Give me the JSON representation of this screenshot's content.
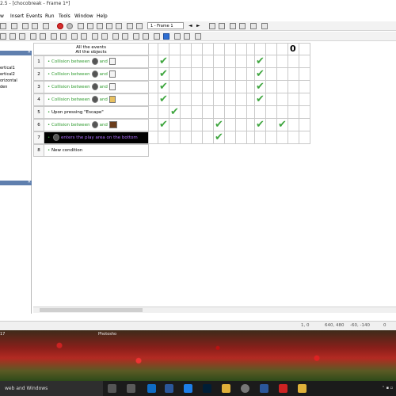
{
  "window": {
    "title": "2.5 - [chocobreak - Frame 1*]"
  },
  "menu": [
    "w",
    "Insert",
    "Events",
    "Run",
    "Tools",
    "Window",
    "Help"
  ],
  "toolbar": {
    "frame_select": "1 - Frame 1"
  },
  "left_panel": {
    "items": [
      "ertical1",
      "ertical2",
      "orizontal",
      "den"
    ]
  },
  "editor": {
    "header_line1": "All the events",
    "header_line2": "All the objects",
    "rows": [
      {
        "num": "1",
        "bullet": "•",
        "pre": "Collision between",
        "and": "and"
      },
      {
        "num": "2",
        "bullet": "•",
        "pre": "Collision between",
        "and": "and"
      },
      {
        "num": "3",
        "bullet": "•",
        "pre": "Collision between",
        "and": "and"
      },
      {
        "num": "4",
        "bullet": "•",
        "pre": "Collision between",
        "and": "and"
      },
      {
        "num": "5",
        "bullet": "•",
        "text": "Upon pressing \"Escape\""
      },
      {
        "num": "6",
        "bullet": "•",
        "pre": "Collision between",
        "and": "and"
      },
      {
        "num": "7",
        "bullet": "•",
        "text": "enters the play area on the bottom"
      },
      {
        "num": "8",
        "bullet": "•",
        "text": "New condition"
      }
    ],
    "zero_label": "0",
    "checkmarks": [
      [
        1,
        1
      ],
      [
        1,
        10
      ],
      [
        2,
        1
      ],
      [
        2,
        10
      ],
      [
        3,
        1
      ],
      [
        3,
        10
      ],
      [
        4,
        1
      ],
      [
        4,
        10
      ],
      [
        5,
        2
      ],
      [
        6,
        1
      ],
      [
        6,
        6
      ],
      [
        6,
        10
      ],
      [
        6,
        12
      ],
      [
        7,
        6
      ]
    ]
  },
  "status": {
    "pos": "1, 0",
    "size": "640, 480",
    "coords": "-60, -140",
    "zoom": "0"
  },
  "desktop": {
    "label_left": "17",
    "label_mid": "Photosho"
  },
  "taskbar": {
    "search": "web and Windows"
  }
}
